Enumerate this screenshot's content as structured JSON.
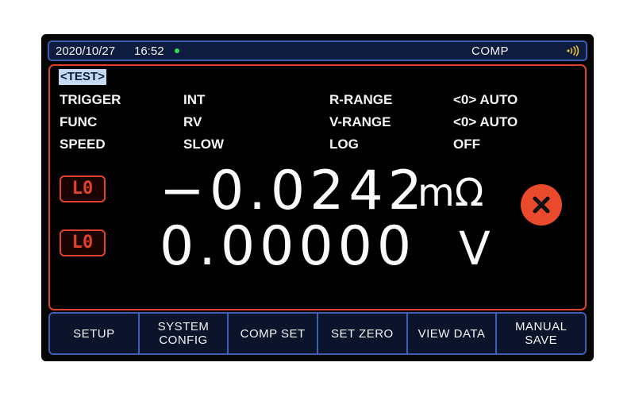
{
  "status": {
    "date": "2020/10/27",
    "time": "16:52",
    "mode": "COMP",
    "signal_icon": "wifi-signal-icon"
  },
  "test_label": "<TEST>",
  "params": {
    "trigger_label": "TRIGGER",
    "trigger_value": "INT",
    "func_label": "FUNC",
    "func_value": "RV",
    "speed_label": "SPEED",
    "speed_value": "SLOW",
    "rrange_label": "R-RANGE",
    "rrange_value": "<0> AUTO",
    "vrange_label": "V-RANGE",
    "vrange_value": "<0> AUTO",
    "log_label": "LOG",
    "log_value": "OFF"
  },
  "measurements": {
    "resistance": {
      "badge": "L0",
      "value": "−0.0242",
      "unit": "mΩ"
    },
    "voltage": {
      "badge": "L0",
      "value": "0.00000",
      "unit": "V"
    }
  },
  "result_icon": "fail-x-icon",
  "colors": {
    "accent_red": "#e2412c",
    "frame_blue": "#3c5fb0",
    "status_ok": "#30e050"
  },
  "softkeys": [
    {
      "label": "SETUP"
    },
    {
      "label": "SYSTEM\nCONFIG"
    },
    {
      "label": "COMP  SET"
    },
    {
      "label": "SET  ZERO"
    },
    {
      "label": "VIEW  DATA"
    },
    {
      "label": "MANUAL\nSAVE"
    }
  ]
}
